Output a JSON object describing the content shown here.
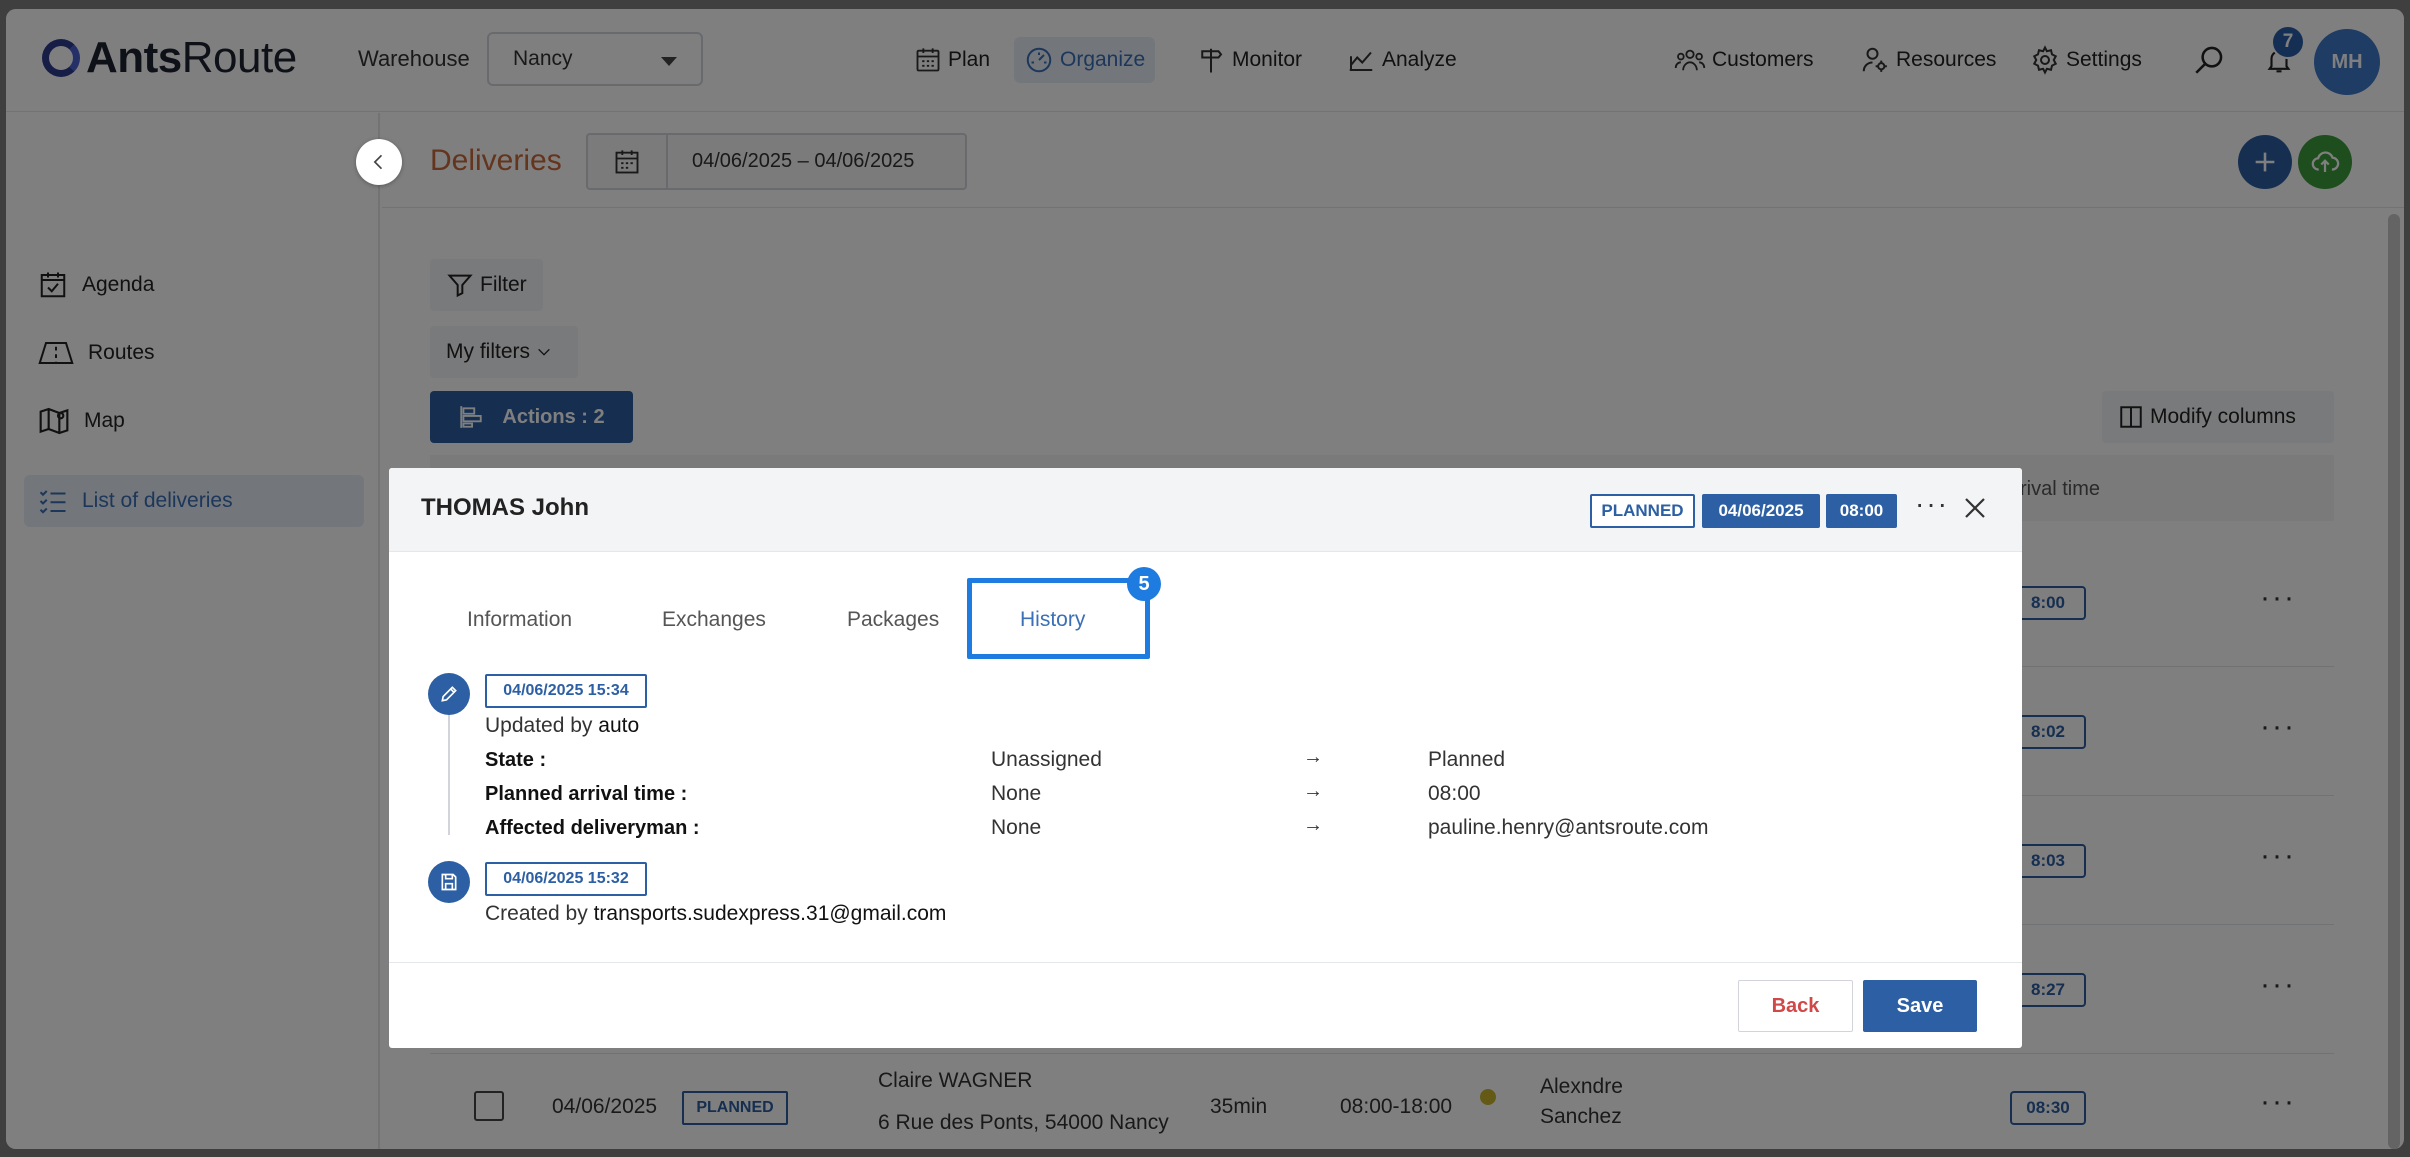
{
  "header": {
    "logo_bold": "Ants",
    "logo_light": "Route",
    "warehouse_label": "Warehouse",
    "warehouse_value": "Nancy",
    "nav": [
      {
        "label": "Plan",
        "icon": "calendar-grid-icon"
      },
      {
        "label": "Organize",
        "icon": "gauge-icon",
        "active": true
      },
      {
        "label": "Monitor",
        "icon": "signpost-icon"
      },
      {
        "label": "Analyze",
        "icon": "chart-icon"
      }
    ],
    "right_nav": [
      {
        "label": "Customers",
        "icon": "people-icon"
      },
      {
        "label": "Resources",
        "icon": "person-gear-icon"
      },
      {
        "label": "Settings",
        "icon": "gear-icon"
      }
    ],
    "notification_count": "7",
    "avatar_initials": "MH"
  },
  "sidebar": {
    "items": [
      {
        "label": "Agenda",
        "icon": "calendar-check-icon"
      },
      {
        "label": "Routes",
        "icon": "route-icon"
      },
      {
        "label": "Map",
        "icon": "map-icon"
      },
      {
        "label": "List of deliveries",
        "icon": "list-icon",
        "active": true
      }
    ]
  },
  "page": {
    "title": "Deliveries",
    "date_range": "04/06/2025 – 04/06/2025",
    "filter_label": "Filter",
    "my_filters_label": "My filters",
    "actions_label": "Actions : 2",
    "modify_columns_label": "Modify columns",
    "column_partial": "rival time",
    "row_times": [
      "8:00",
      "8:02",
      "8:03",
      "8:27"
    ]
  },
  "last_row": {
    "date": "04/06/2025",
    "status": "PLANNED",
    "customer": "Claire WAGNER",
    "address": "6 Rue des Ponts, 54000 Nancy",
    "duration": "35min",
    "window": "08:00-18:00",
    "driver_line1": "Alexndre",
    "driver_line2": "Sanchez",
    "time": "08:30"
  },
  "modal": {
    "title": "THOMAS John",
    "status_tag": "PLANNED",
    "date_tag": "04/06/2025",
    "time_tag": "08:00",
    "tabs": [
      "Information",
      "Exchanges",
      "Packages",
      "History"
    ],
    "active_tab_index": 3,
    "annotation_number": "5",
    "history": [
      {
        "icon": "pencil-icon",
        "timestamp": "04/06/2025 15:34",
        "by_prefix": "Updated by",
        "by_user": "auto",
        "changes": [
          {
            "field": "State :",
            "old": "Unassigned",
            "new": "Planned"
          },
          {
            "field": "Planned arrival time :",
            "old": "None",
            "new": "08:00"
          },
          {
            "field": "Affected deliveryman :",
            "old": "None",
            "new": "pauline.henry@antsroute.com"
          }
        ]
      },
      {
        "icon": "save-icon",
        "timestamp": "04/06/2025 15:32",
        "by_prefix": "Created by",
        "by_user": "transports.sudexpress.31@gmail.com"
      }
    ],
    "arrow": "→",
    "back_label": "Back",
    "save_label": "Save"
  },
  "colors": {
    "primary": "#2c5fa3",
    "accent_orange": "#c9683b",
    "highlight": "#1e7be0",
    "back_red": "#d14848"
  }
}
